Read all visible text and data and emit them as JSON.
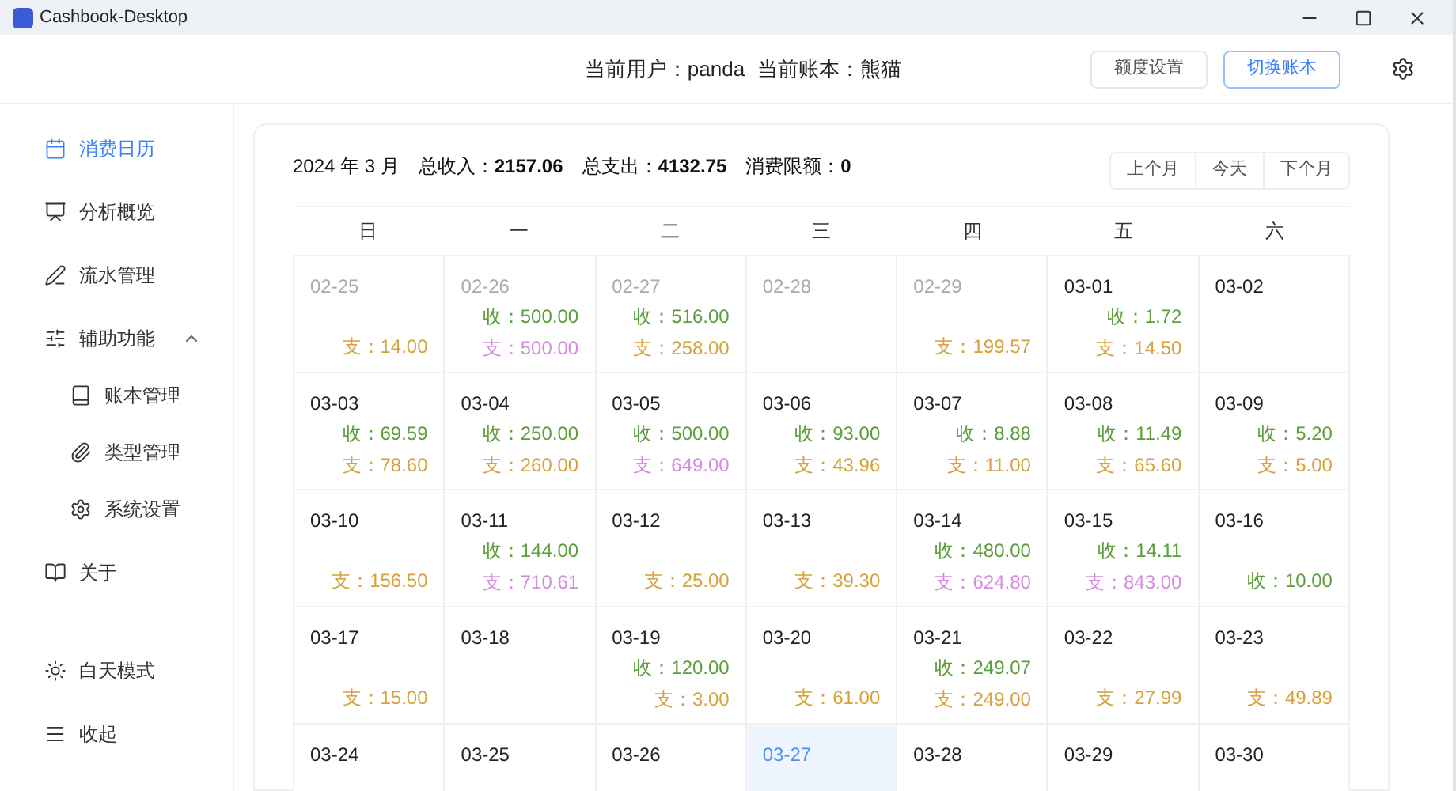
{
  "window": {
    "title": "Cashbook-Desktop"
  },
  "header": {
    "user_label": "当前用户：",
    "user": "panda",
    "book_label": "当前账本：",
    "book": "熊猫",
    "buttons": [
      {
        "label": "额度设置",
        "selected": false
      },
      {
        "label": "切换账本",
        "selected": true
      }
    ]
  },
  "sidebar": {
    "items": [
      {
        "label": "消费日历",
        "selected": true
      },
      {
        "label": "分析概览",
        "selected": false
      },
      {
        "label": "流水管理",
        "selected": false
      },
      {
        "label": "辅助功能",
        "selected": false,
        "expanded": true,
        "children": [
          {
            "label": "账本管理",
            "selected": false
          },
          {
            "label": "类型管理",
            "selected": false
          },
          {
            "label": "系统设置",
            "selected": false
          }
        ]
      },
      {
        "label": "关于",
        "selected": false
      }
    ],
    "bottom": [
      {
        "label": "白天模式"
      },
      {
        "label": "收起"
      }
    ]
  },
  "summary": {
    "month": "2024 年 3 月",
    "income_label": "总收入：",
    "income": "2157.06",
    "expense_label": "总支出：",
    "expense": "4132.75",
    "limit_label": "消费限额：",
    "limit": "0"
  },
  "nav_buttons": [
    "上个月",
    "今天",
    "下个月"
  ],
  "weekdays": [
    "日",
    "一",
    "二",
    "三",
    "四",
    "五",
    "六"
  ],
  "days": [
    {
      "date": "02-25",
      "muted": true,
      "selected": false,
      "expense": {
        "text": "支：14.00",
        "color": "#d6a23e"
      }
    },
    {
      "date": "02-26",
      "muted": true,
      "selected": false,
      "income": "收：500.00",
      "expense": {
        "text": "支：500.00",
        "color": "#d58be0"
      }
    },
    {
      "date": "02-27",
      "muted": true,
      "selected": false,
      "income": "收：516.00",
      "expense": {
        "text": "支：258.00",
        "color": "#d6a23e"
      }
    },
    {
      "date": "02-28",
      "muted": true,
      "selected": false
    },
    {
      "date": "02-29",
      "muted": true,
      "selected": false,
      "expense": {
        "text": "支：199.57",
        "color": "#d6a23e"
      }
    },
    {
      "date": "03-01",
      "muted": false,
      "selected": false,
      "income": "收：1.72",
      "expense": {
        "text": "支：14.50",
        "color": "#d6a23e"
      }
    },
    {
      "date": "03-02",
      "muted": false,
      "selected": false
    },
    {
      "date": "03-03",
      "muted": false,
      "selected": false,
      "income": "收：69.59",
      "expense": {
        "text": "支：78.60",
        "color": "#d6a23e"
      }
    },
    {
      "date": "03-04",
      "muted": false,
      "selected": false,
      "income": "收：250.00",
      "expense": {
        "text": "支：260.00",
        "color": "#d6a23e"
      }
    },
    {
      "date": "03-05",
      "muted": false,
      "selected": false,
      "income": "收：500.00",
      "expense": {
        "text": "支：649.00",
        "color": "#d58be0"
      }
    },
    {
      "date": "03-06",
      "muted": false,
      "selected": false,
      "income": "收：93.00",
      "expense": {
        "text": "支：43.96",
        "color": "#d6a23e"
      }
    },
    {
      "date": "03-07",
      "muted": false,
      "selected": false,
      "income": "收：8.88",
      "expense": {
        "text": "支：11.00",
        "color": "#d6a23e"
      }
    },
    {
      "date": "03-08",
      "muted": false,
      "selected": false,
      "income": "收：11.49",
      "expense": {
        "text": "支：65.60",
        "color": "#d6a23e"
      }
    },
    {
      "date": "03-09",
      "muted": false,
      "selected": false,
      "income": "收：5.20",
      "expense": {
        "text": "支：5.00",
        "color": "#d6a23e"
      }
    },
    {
      "date": "03-10",
      "muted": false,
      "selected": false,
      "expense": {
        "text": "支：156.50",
        "color": "#d6a23e"
      }
    },
    {
      "date": "03-11",
      "muted": false,
      "selected": false,
      "income": "收：144.00",
      "expense": {
        "text": "支：710.61",
        "color": "#d58be0"
      }
    },
    {
      "date": "03-12",
      "muted": false,
      "selected": false,
      "expense": {
        "text": "支：25.00",
        "color": "#d6a23e"
      }
    },
    {
      "date": "03-13",
      "muted": false,
      "selected": false,
      "expense": {
        "text": "支：39.30",
        "color": "#d6a23e"
      }
    },
    {
      "date": "03-14",
      "muted": false,
      "selected": false,
      "income": "收：480.00",
      "expense": {
        "text": "支：624.80",
        "color": "#d58be0"
      }
    },
    {
      "date": "03-15",
      "muted": false,
      "selected": false,
      "income": "收：14.11",
      "expense": {
        "text": "支：843.00",
        "color": "#d58be0"
      }
    },
    {
      "date": "03-16",
      "muted": false,
      "selected": false,
      "income": "收：10.00"
    },
    {
      "date": "03-17",
      "muted": false,
      "selected": false,
      "expense": {
        "text": "支：15.00",
        "color": "#d6a23e"
      }
    },
    {
      "date": "03-18",
      "muted": false,
      "selected": false
    },
    {
      "date": "03-19",
      "muted": false,
      "selected": false,
      "income": "收：120.00",
      "expense": {
        "text": "支：3.00",
        "color": "#d6a23e"
      }
    },
    {
      "date": "03-20",
      "muted": false,
      "selected": false,
      "expense": {
        "text": "支：61.00",
        "color": "#d6a23e"
      }
    },
    {
      "date": "03-21",
      "muted": false,
      "selected": false,
      "income": "收：249.07",
      "expense": {
        "text": "支：249.00",
        "color": "#d6a23e"
      }
    },
    {
      "date": "03-22",
      "muted": false,
      "selected": false,
      "expense": {
        "text": "支：27.99",
        "color": "#d6a23e"
      }
    },
    {
      "date": "03-23",
      "muted": false,
      "selected": false,
      "expense": {
        "text": "支：49.89",
        "color": "#d6a23e"
      }
    },
    {
      "date": "03-24",
      "muted": false,
      "selected": false
    },
    {
      "date": "03-25",
      "muted": false,
      "selected": false
    },
    {
      "date": "03-26",
      "muted": false,
      "selected": false
    },
    {
      "date": "03-27",
      "muted": false,
      "selected": true
    },
    {
      "date": "03-28",
      "muted": false,
      "selected": false
    },
    {
      "date": "03-29",
      "muted": false,
      "selected": false
    },
    {
      "date": "03-30",
      "muted": false,
      "selected": false
    }
  ]
}
